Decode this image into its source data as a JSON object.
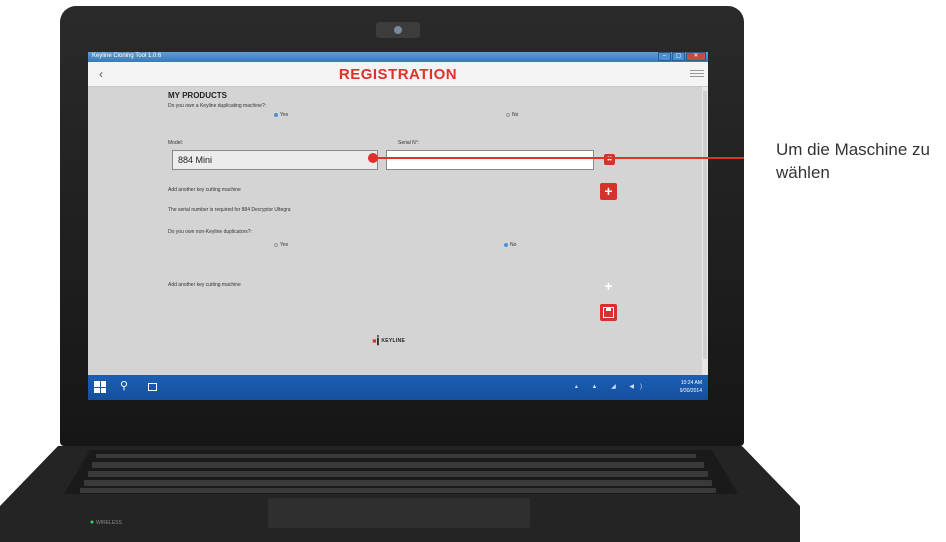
{
  "window": {
    "title": "Keyline Cloning Tool 1.0.6",
    "buttons": [
      "–",
      "▢",
      "✕"
    ]
  },
  "header": {
    "back_icon": "‹",
    "title": "REGISTRATION",
    "menu_icon": "hamburger-icon"
  },
  "products": {
    "section_title": "MY PRODUCTS",
    "q1": "Do you own a Keyline duplicating machine?:",
    "q1_options": {
      "yes": "Yes",
      "no": "No",
      "selected": "yes"
    },
    "model_label": "Model:",
    "serial_label": "Serial N°:",
    "model_value": "884 Mini",
    "serial_value": "",
    "add_machine_1": "Add another key cutting machine",
    "serial_note": "The serial number is required for 884 Decryptor Ultegra",
    "q2": "Do you own non-Keyline duplicators?:",
    "q2_options": {
      "yes": "Yes",
      "no": "No",
      "selected": "no"
    },
    "add_machine_2": "Add another key cutting machine",
    "delete_icon": "✖",
    "add_icon": "+"
  },
  "logo": {
    "mark": "Ꭵ",
    "word": "KEYLINE"
  },
  "taskbar": {
    "search_icon": "⚲",
    "tray": "▴ ▲ ◢ ◀)",
    "time": "10:24 AM",
    "date": "9/30/2014"
  },
  "keyboard": {
    "wireless": "WIRELESS"
  },
  "annotation": {
    "text": "Um die Maschine zu wählen"
  },
  "colors": {
    "accent": "#e0312c",
    "taskbar": "#1b5fb6"
  }
}
